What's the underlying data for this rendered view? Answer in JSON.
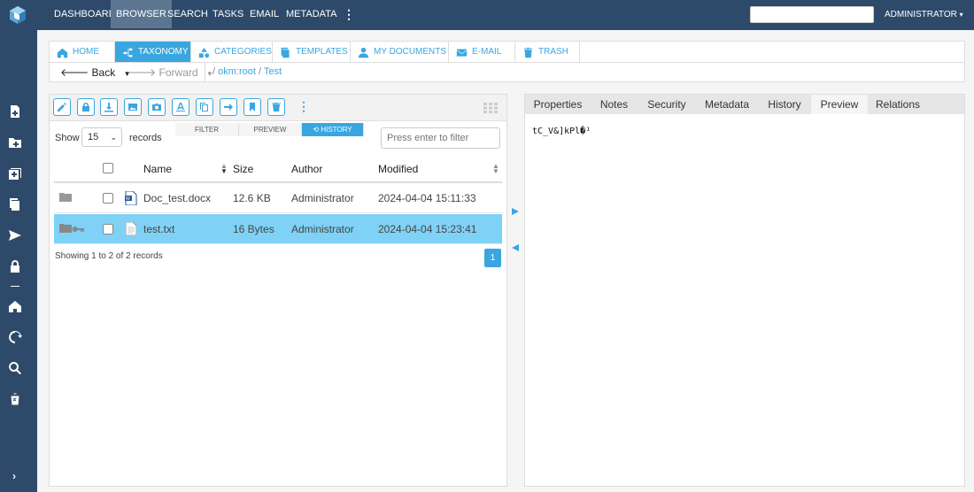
{
  "topbar": {
    "nav": [
      {
        "label": "DASHBOARD",
        "active": false
      },
      {
        "label": "BROWSER",
        "active": true
      },
      {
        "label": "SEARCH",
        "active": false
      },
      {
        "label": "TASKS",
        "active": false
      },
      {
        "label": "EMAIL",
        "active": false
      },
      {
        "label": "METADATA",
        "active": false
      }
    ],
    "more_icon": "⋮",
    "search_placeholder": "",
    "user": "ADMINISTRATOR",
    "user_caret": "▾"
  },
  "sidebar": {
    "icons": [
      "new-document-icon",
      "new-folder-icon",
      "add-icon",
      "copy-icon",
      "send-icon",
      "lock-icon",
      "home-icon",
      "refresh-icon",
      "search-icon",
      "trash-icon"
    ],
    "collapse_icon": "›"
  },
  "tabs": [
    {
      "label": "HOME",
      "icon": "home-icon",
      "active": false
    },
    {
      "label": "TAXONOMY",
      "icon": "taxonomy-icon",
      "active": true
    },
    {
      "label": "CATEGORIES",
      "icon": "categories-icon",
      "active": false
    },
    {
      "label": "TEMPLATES",
      "icon": "templates-icon",
      "active": false
    },
    {
      "label": "MY DOCUMENTS",
      "icon": "user-icon",
      "active": false
    },
    {
      "label": "E-MAIL",
      "icon": "envelope-icon",
      "active": false
    },
    {
      "label": "TRASH",
      "icon": "trash-icon",
      "active": false
    }
  ],
  "breadcrumb": {
    "back_label": "Back",
    "forward_label": "Forward",
    "sep": "/",
    "path": [
      "okm:root",
      "Test"
    ]
  },
  "toolbar": {
    "buttons": [
      "edit-icon",
      "lock-icon",
      "download-icon",
      "image-icon",
      "camera-icon",
      "text-icon",
      "copy-icon",
      "move-icon",
      "bookmark-icon",
      "delete-icon"
    ],
    "more": "⋮",
    "grid_icon": "grid-view-icon"
  },
  "list": {
    "show_label": "Show",
    "page_size": "15",
    "records_label": "records",
    "subtabs": [
      {
        "label": "FILTER",
        "active": false
      },
      {
        "label": "PREVIEW",
        "active": false
      },
      {
        "label": "⟲ HISTORY",
        "active": true
      }
    ],
    "filter_placeholder": "Press enter to filter",
    "columns": {
      "name": "Name",
      "size": "Size",
      "author": "Author",
      "modified": "Modified"
    },
    "rows": [
      {
        "name": "Doc_test.docx",
        "size": "12.6 KB",
        "author": "Administrator",
        "modified": "2024-04-04 15:11:33",
        "file_icon": "word-document-icon",
        "status_icons": [
          "folder-status-icon"
        ],
        "selected": false
      },
      {
        "name": "test.txt",
        "size": "16 Bytes",
        "author": "Administrator",
        "modified": "2024-04-04 15:23:41",
        "file_icon": "text-file-icon",
        "status_icons": [
          "folder-status-icon",
          "key-icon"
        ],
        "selected": true
      }
    ],
    "paging_info": "Showing 1 to 2 of 2 records",
    "current_page": "1"
  },
  "right_panel": {
    "tabs": [
      {
        "label": "Properties",
        "active": false
      },
      {
        "label": "Notes",
        "active": false
      },
      {
        "label": "Security",
        "active": false
      },
      {
        "label": "Metadata",
        "active": false
      },
      {
        "label": "History",
        "active": false
      },
      {
        "label": "Preview",
        "active": true
      },
      {
        "label": "Relations",
        "active": false
      }
    ],
    "preview_text": "tC̲V&]kPl�¹"
  },
  "colors": {
    "topbar": "#2e4a6b",
    "accent": "#3aa6e0",
    "selected_row": "#7fd2f5"
  }
}
